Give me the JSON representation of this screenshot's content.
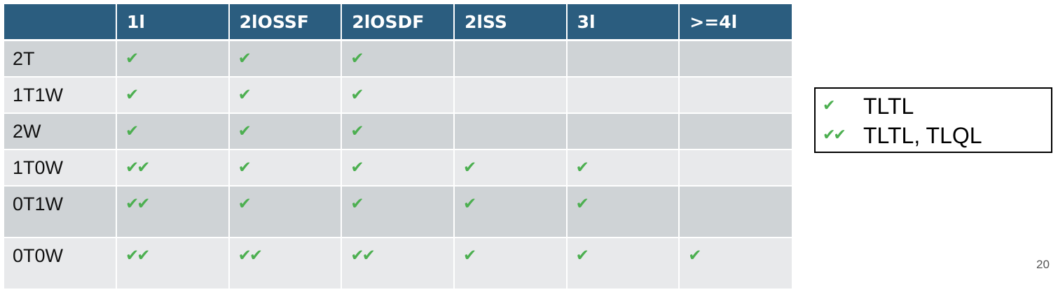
{
  "table": {
    "corner": "",
    "columns": [
      "1l",
      "2lOSSF",
      "2lOSDF",
      "2lSS",
      "3l",
      ">=4l"
    ],
    "rows": [
      {
        "label": "2T",
        "cells": [
          "✔",
          "✔",
          "✔",
          "",
          "",
          ""
        ]
      },
      {
        "label": "1T1W",
        "cells": [
          "✔",
          "✔",
          "✔",
          "",
          "",
          ""
        ]
      },
      {
        "label": "2W",
        "cells": [
          "✔",
          "✔",
          "✔",
          "",
          "",
          ""
        ]
      },
      {
        "label": "1T0W",
        "cells": [
          "✔✔",
          "✔",
          "✔",
          "✔",
          "✔",
          ""
        ]
      },
      {
        "label": "0T1W",
        "cells": [
          "✔✔",
          "✔",
          "✔",
          "✔",
          "✔",
          ""
        ]
      },
      {
        "label": "0T0W",
        "cells": [
          "✔✔",
          "✔✔",
          "✔✔",
          "✔",
          "✔",
          "✔"
        ]
      }
    ]
  },
  "legend": {
    "items": [
      {
        "mark": "✔",
        "text": "TLTL"
      },
      {
        "mark": "✔✔",
        "text": "TLTL, TLQL"
      }
    ]
  },
  "page_number": "20",
  "colors": {
    "header_bg": "#2b5d7f",
    "row_dark": "#cfd3d6",
    "row_light": "#e8e9eb",
    "check": "#4caf50"
  }
}
